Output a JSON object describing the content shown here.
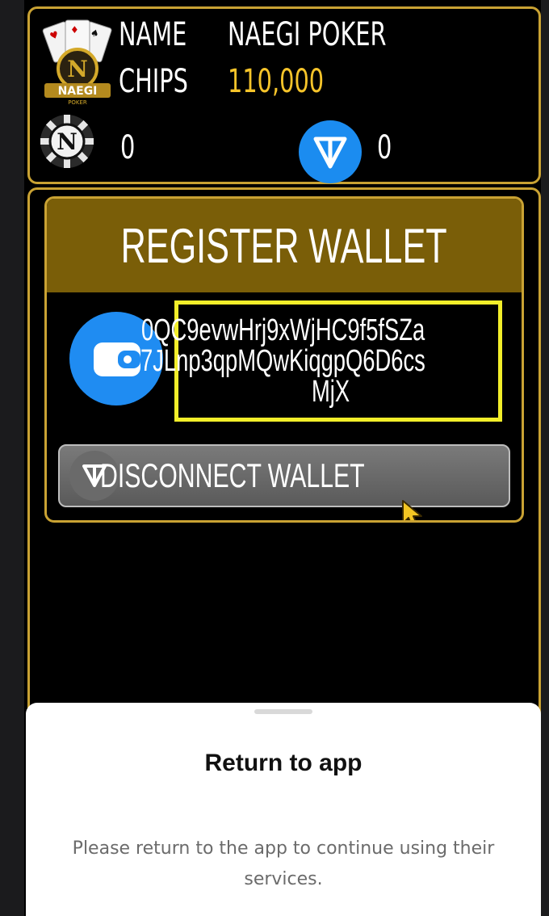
{
  "profile": {
    "name_label": "NAME",
    "name_value": "NAEGI POKER",
    "chips_label": "CHIPS",
    "chips_value": "110,000",
    "logo_text": "NAEGI",
    "chip_letter": "N",
    "n_token_balance": "0",
    "ton_balance": "0"
  },
  "wallet_card": {
    "title": "REGISTER WALLET",
    "address_lines": [
      "0QC9evwHrj9xWjHC9f5fSZa",
      "7JLnp3qpMQwKiqgpQ6D6cs",
      "MjX"
    ],
    "disconnect_label": "DISCONNECT WALLET"
  },
  "bottom_sheet": {
    "title": "Return to app",
    "message": "Please return to the app to continue using their services."
  },
  "colors": {
    "gold_border": "#c9a233",
    "chips_value": "#f6c42a",
    "header_band": "#7a5e08",
    "ton_blue": "#1b8cf0",
    "highlight": "#f2ee2a"
  },
  "icons": [
    "naegi-poker-logo-icon",
    "n-chip-icon",
    "ton-icon",
    "wallet-icon",
    "cursor-icon"
  ]
}
